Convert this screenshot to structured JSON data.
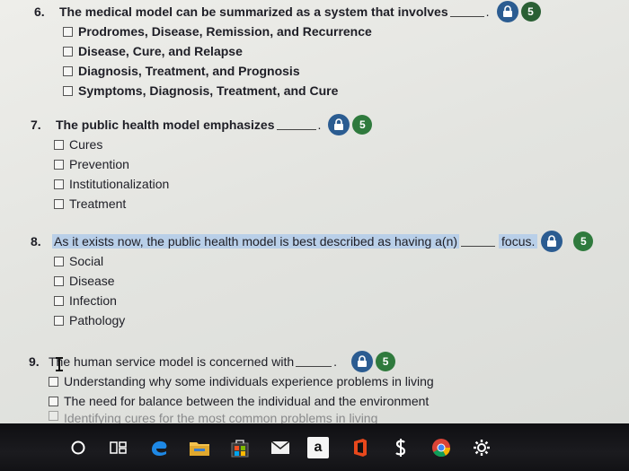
{
  "questions": [
    {
      "number": "6.",
      "prompt": "The medical model can be summarized as a system that involves",
      "badge": "5",
      "options": [
        "Prodromes, Disease, Remission, and Recurrence",
        "Disease, Cure, and Relapse",
        "Diagnosis, Treatment, and Prognosis",
        "Symptoms, Diagnosis, Treatment, and Cure"
      ]
    },
    {
      "number": "7.",
      "prompt": "The public health model emphasizes",
      "badge": "5",
      "options": [
        "Cures",
        "Prevention",
        "Institutionalization",
        "Treatment"
      ]
    },
    {
      "number": "8.",
      "prompt": "As it exists now, the public health model is best described as having a(n)",
      "suffix": "focus.",
      "badge": "5",
      "options": [
        "Social",
        "Disease",
        "Infection",
        "Pathology"
      ]
    },
    {
      "number": "9.",
      "prompt": "The human service model is concerned with",
      "badge": "5",
      "options": [
        "Understanding why some individuals experience problems in living",
        "The need for balance between the individual and the environment",
        "Identifying cures for the most common problems in living"
      ]
    }
  ],
  "taskbar": {
    "icons": [
      "cortana-icon",
      "task-view-icon",
      "edge-icon",
      "file-explorer-icon",
      "store-icon",
      "mail-icon",
      "amazon-icon",
      "office-icon",
      "dollar-icon",
      "chrome-icon",
      "settings-icon"
    ],
    "amazon_label": "a"
  },
  "colors": {
    "badge_blue": "#2b5c91",
    "badge_green": "#2f7a3d",
    "highlight": "#b9cfe8",
    "taskbar": "#141417"
  }
}
